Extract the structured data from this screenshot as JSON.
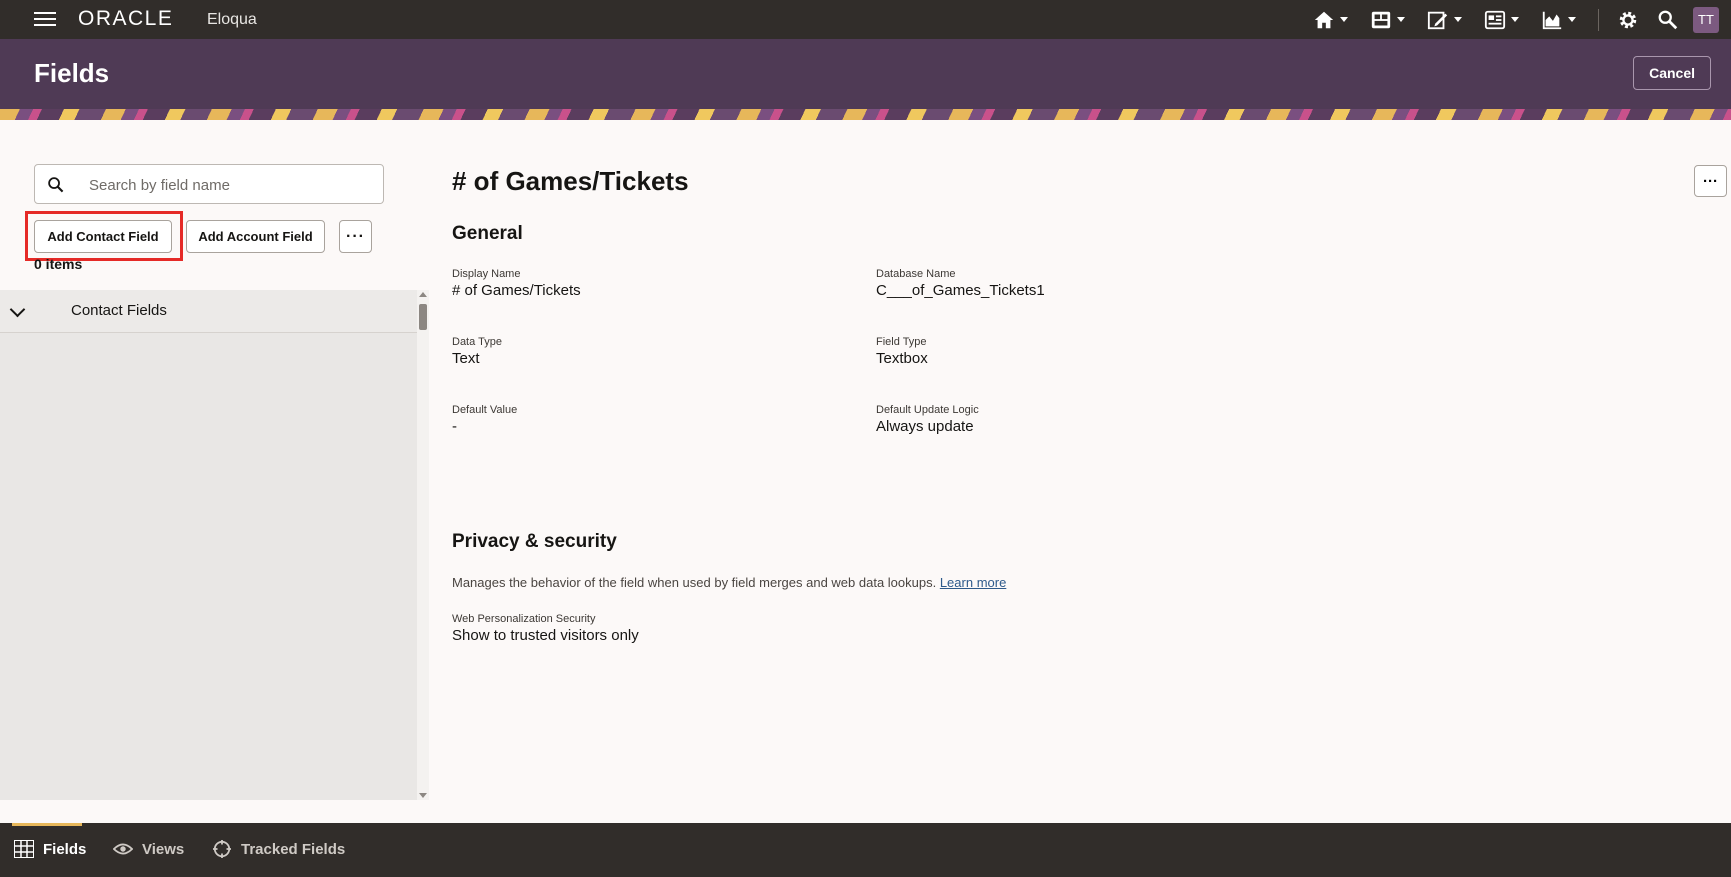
{
  "topbar": {
    "brand": "ORACLE",
    "product": "Eloqua",
    "nav_icons": [
      "home-icon",
      "dashboard-icon",
      "edit-icon",
      "grid-icon",
      "chart-icon",
      "gear-icon",
      "search-icon"
    ],
    "user_initials": "TT"
  },
  "header": {
    "title": "Fields",
    "cancel_label": "Cancel"
  },
  "left_panel": {
    "search_placeholder": "Search by field name",
    "add_contact_label": "Add Contact Field",
    "add_account_label": "Add Account Field",
    "more_label": "···",
    "item_count": "0 items",
    "tree_group": "Contact Fields"
  },
  "detail": {
    "title": "# of Games/Tickets",
    "more_label": "···",
    "general": {
      "heading": "General",
      "display_name_label": "Display Name",
      "display_name": "# of Games/Tickets",
      "database_name_label": "Database Name",
      "database_name": "C___of_Games_Tickets1",
      "data_type_label": "Data Type",
      "data_type": "Text",
      "field_type_label": "Field Type",
      "field_type": "Textbox",
      "default_value_label": "Default Value",
      "default_value": "-",
      "update_logic_label": "Default Update Logic",
      "update_logic": "Always update"
    },
    "privacy": {
      "heading": "Privacy & security",
      "description": "Manages the behavior of the field when used by field merges and web data lookups.",
      "learn_more": "Learn more",
      "web_security_label": "Web Personalization Security",
      "web_security": "Show to trusted visitors only"
    }
  },
  "bottom_tabs": {
    "fields": "Fields",
    "views": "Views",
    "tracked": "Tracked Fields"
  },
  "colors": {
    "topbar": "#312d2a",
    "header": "#4f3a55",
    "highlight": "#e52a27",
    "tab_indicator": "#e7b75a"
  }
}
